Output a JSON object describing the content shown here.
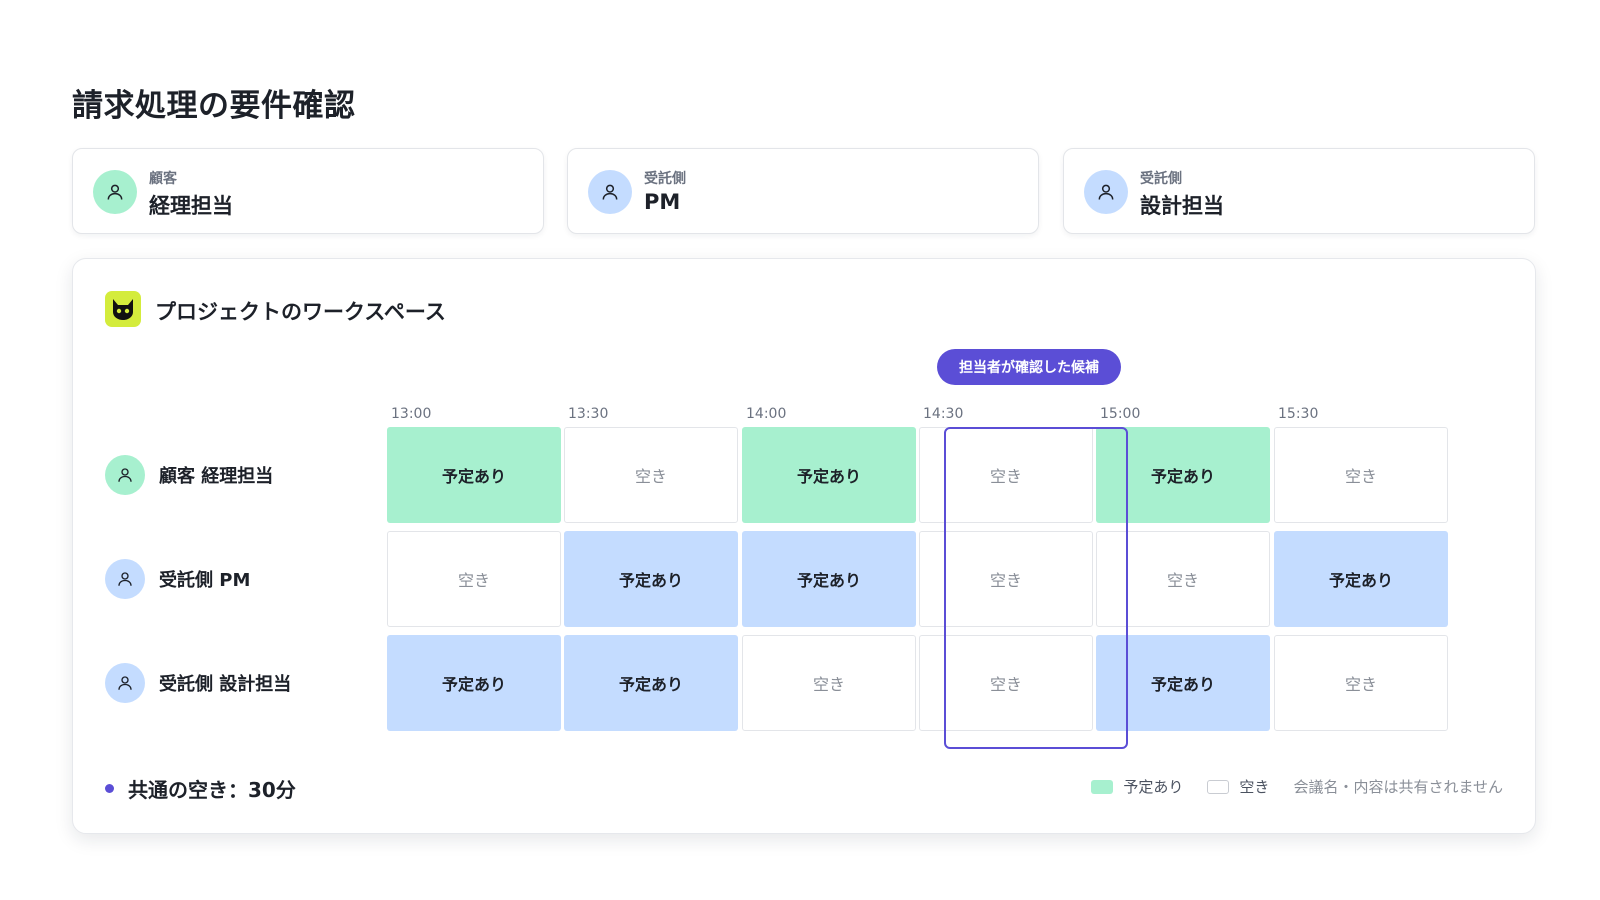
{
  "page_title": "請求処理の要件確認",
  "participants": [
    {
      "role": "顧客",
      "name": "経理担当",
      "color": "#a7f0cf"
    },
    {
      "role": "受託側",
      "name": "PM",
      "color": "#c4dcff"
    },
    {
      "role": "受託側",
      "name": "設計担当",
      "color": "#c4dcff"
    }
  ],
  "workspace": {
    "title": "プロジェクトのワークスペース",
    "logo_icon": "cat-face-icon",
    "candidate_badge": "担当者が確認した候補",
    "times": [
      "13:00",
      "13:30",
      "14:00",
      "14:30",
      "15:00",
      "15:30"
    ],
    "highlighted_time": "14:30",
    "rows": [
      {
        "label": "顧客 経理担当",
        "color": "#a7f0cf",
        "cells": [
          "予定あり",
          "空き",
          "予定あり",
          "空き",
          "予定あり",
          "空き"
        ]
      },
      {
        "label": "受託側 PM",
        "color": "#c4dcff",
        "cells": [
          "空き",
          "予定あり",
          "予定あり",
          "空き",
          "空き",
          "予定あり"
        ]
      },
      {
        "label": "受託側 設計担当",
        "color": "#c4dcff",
        "cells": [
          "予定あり",
          "予定あり",
          "空き",
          "空き",
          "予定あり",
          "空き"
        ]
      }
    ],
    "summary": "共通の空き：30分",
    "legend": {
      "busy": "予定あり",
      "free": "空き",
      "note": "会議名・内容は共有されません"
    }
  },
  "colors": {
    "accent": "#5b4ed6",
    "busy_green": "#a7f0cf",
    "busy_blue": "#c4dcff",
    "logo_bg": "#d4ec3c"
  }
}
